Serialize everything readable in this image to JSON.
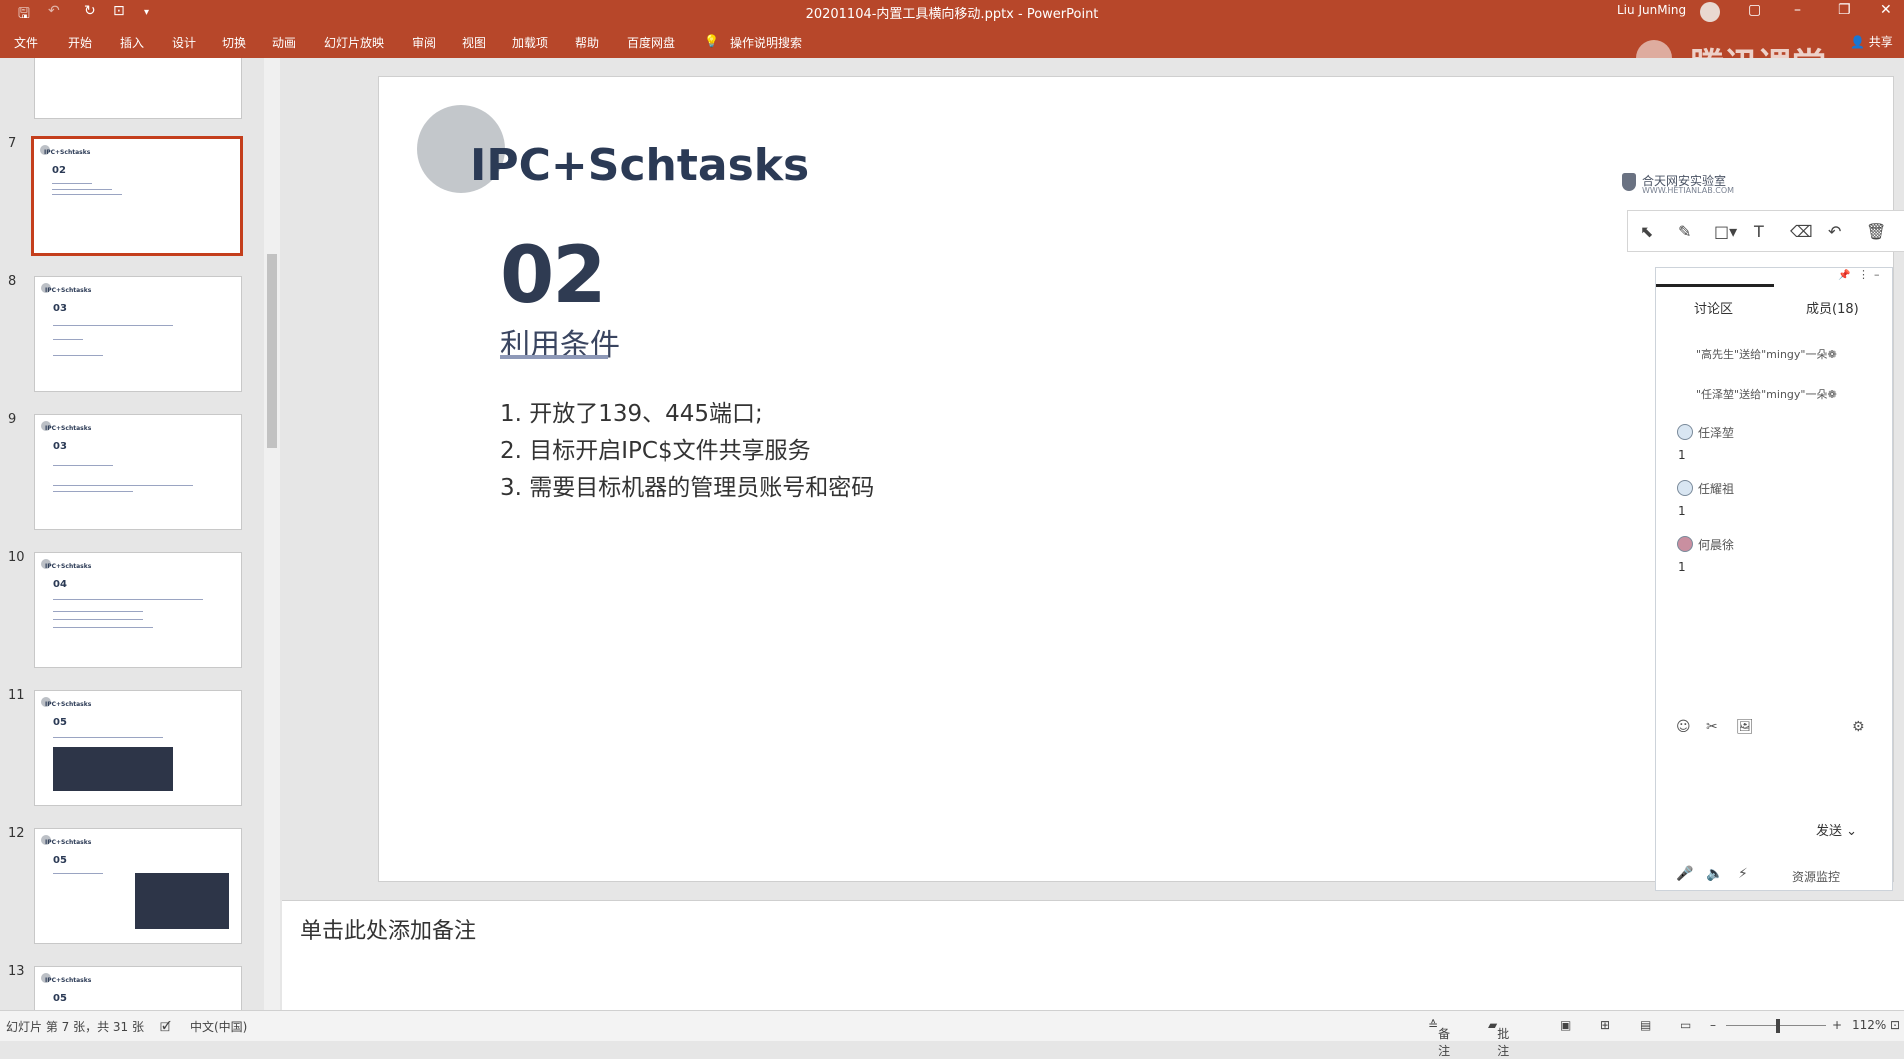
{
  "window": {
    "title": "20201104-内置工具横向移动.pptx  -  PowerPoint",
    "user": "Liu JunMing",
    "quick_access": {
      "save": "🖫",
      "undo": "↶",
      "redo": "↻",
      "present": "⊡",
      "customize": "▾"
    },
    "controls": {
      "layout": "▢",
      "minimize": "–",
      "restore": "❐",
      "close": "✕"
    }
  },
  "ribbon": {
    "tabs": [
      "文件",
      "开始",
      "插入",
      "设计",
      "切换",
      "动画",
      "幻灯片放映",
      "审阅",
      "视图",
      "加载项",
      "帮助",
      "百度网盘"
    ],
    "search": "操作说明搜索",
    "share": "共享"
  },
  "watermark": "腾讯课堂",
  "thumbnails": [
    {
      "number": "7",
      "title": "IPC+Schtasks",
      "num": "02",
      "selected": true
    },
    {
      "number": "8",
      "title": "IPC+Schtasks",
      "num": "03",
      "selected": false
    },
    {
      "number": "9",
      "title": "IPC+Schtasks",
      "num": "03",
      "selected": false
    },
    {
      "number": "10",
      "title": "IPC+Schtasks",
      "num": "04",
      "selected": false
    },
    {
      "number": "11",
      "title": "IPC+Schtasks",
      "num": "05",
      "selected": false
    },
    {
      "number": "12",
      "title": "IPC+Schtasks",
      "num": "05",
      "selected": false
    },
    {
      "number": "13",
      "title": "IPC+Schtasks",
      "num": "05",
      "selected": false
    }
  ],
  "slide": {
    "title": "IPC+Schtasks",
    "number": "02",
    "subtitle": "利用条件",
    "items": [
      "1. 开放了139、445端口;",
      "2. 目标开启IPC$文件共享服务",
      "3. 需要目标机器的管理员账号和密码"
    ],
    "logo": "合天网安实验室",
    "logo_url": "WWW.HETIANLAB.COM"
  },
  "annotation_tools": [
    "select-icon",
    "pen-icon",
    "rect-icon",
    "text-icon",
    "eraser-icon",
    "undo-icon",
    "delete-icon"
  ],
  "chat": {
    "tab_discuss": "讨论区",
    "tab_members": "成员(18)",
    "system_messages": [
      "\"高先生\"送给\"mingy\"一朵❁",
      "\"任泽堃\"送给\"mingy\"一朵❁"
    ],
    "messages": [
      {
        "name": "任泽堃",
        "text": "1"
      },
      {
        "name": "任耀祖",
        "text": "1"
      },
      {
        "name": "何晨徐",
        "text": "1"
      }
    ],
    "send": "发送",
    "resource_monitor": "资源监控"
  },
  "notes_placeholder": "单击此处添加备注",
  "status": {
    "slide_info": "幻灯片 第 7 张，共 31 张",
    "language": "中文(中国)",
    "notes": "备注",
    "comments": "批注",
    "zoom": "112%"
  }
}
